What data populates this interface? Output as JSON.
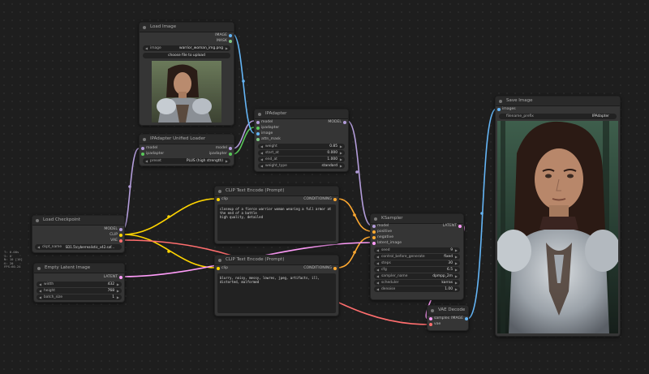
{
  "side_info": [
    "T: 0.00s",
    "I: 0",
    "N: 10 [10]",
    "V: 20",
    "FPS:60.24"
  ],
  "colors": {
    "model": "#b39ddb",
    "clip": "#ffd500",
    "vae": "#ff6e6e",
    "conditioning": "#ffa931",
    "latent": "#ff9cf9",
    "image": "#64b5f6",
    "ipadapter": "#5ac85a",
    "mask": "#81c784"
  },
  "nodes": {
    "load_image": {
      "title": "Load Image",
      "outputs": [
        "IMAGE",
        "MASK"
      ],
      "image_label": "image",
      "image_value": "warrior_woman_img.png",
      "upload_label": "choose file to upload"
    },
    "ipadapter": {
      "title": "IPAdapter",
      "inputs": [
        "model",
        "ipadapter",
        "image",
        "attn_mask"
      ],
      "output": "MODEL",
      "widgets": [
        {
          "label": "weight",
          "value": "0.85"
        },
        {
          "label": "start_at",
          "value": "0.000"
        },
        {
          "label": "end_at",
          "value": "1.000"
        },
        {
          "label": "weight_type",
          "value": "standard"
        }
      ]
    },
    "unified_loader": {
      "title": "IPAdapter Unified Loader",
      "inputs": [
        "model",
        "ipadapter"
      ],
      "outputs": [
        "model",
        "ipadapter"
      ],
      "widgets": [
        {
          "label": "preset",
          "value": "PLUS (high strength)"
        }
      ]
    },
    "clip_pos": {
      "title": "CLIP Text Encode (Prompt)",
      "input": "clip",
      "output": "CONDITIONING",
      "text": "closeup of a fierce warrior woman wearing a full armor at the end of a battle\nhigh quality, detailed"
    },
    "clip_neg": {
      "title": "CLIP Text Encode (Prompt)",
      "input": "clip",
      "output": "CONDITIONING",
      "text": "blurry, noisy, messy, lowres, jpeg, artifacts, ill, distorted, malformed"
    },
    "checkpoint": {
      "title": "Load Checkpoint",
      "outputs": [
        "MODEL",
        "CLIP",
        "VAE"
      ],
      "widgets": [
        {
          "label": "ckpt_name",
          "value": "SD1.5\\cyberrealistic_v42.saf..."
        }
      ]
    },
    "empty_latent": {
      "title": "Empty Latent Image",
      "output": "LATENT",
      "widgets": [
        {
          "label": "width",
          "value": "432"
        },
        {
          "label": "height",
          "value": "768"
        },
        {
          "label": "batch_size",
          "value": "1"
        }
      ]
    },
    "ksampler": {
      "title": "KSampler",
      "inputs": [
        "model",
        "positive",
        "negative",
        "latent_image"
      ],
      "output": "LATENT",
      "widgets": [
        {
          "label": "seed",
          "value": "9"
        },
        {
          "label": "control_before_generate",
          "value": "fixed"
        },
        {
          "label": "steps",
          "value": "30"
        },
        {
          "label": "cfg",
          "value": "6.5"
        },
        {
          "label": "sampler_name",
          "value": "dpmpp_2m"
        },
        {
          "label": "scheduler",
          "value": "karras"
        },
        {
          "label": "denoise",
          "value": "1.00"
        }
      ]
    },
    "vae_decode": {
      "title": "VAE Decode",
      "inputs": [
        "samples",
        "vae"
      ],
      "output": "IMAGE"
    },
    "save_image": {
      "title": "Save Image",
      "input": "images",
      "widgets": [
        {
          "label": "filename_prefix",
          "value": "IPAdapter"
        }
      ]
    }
  }
}
